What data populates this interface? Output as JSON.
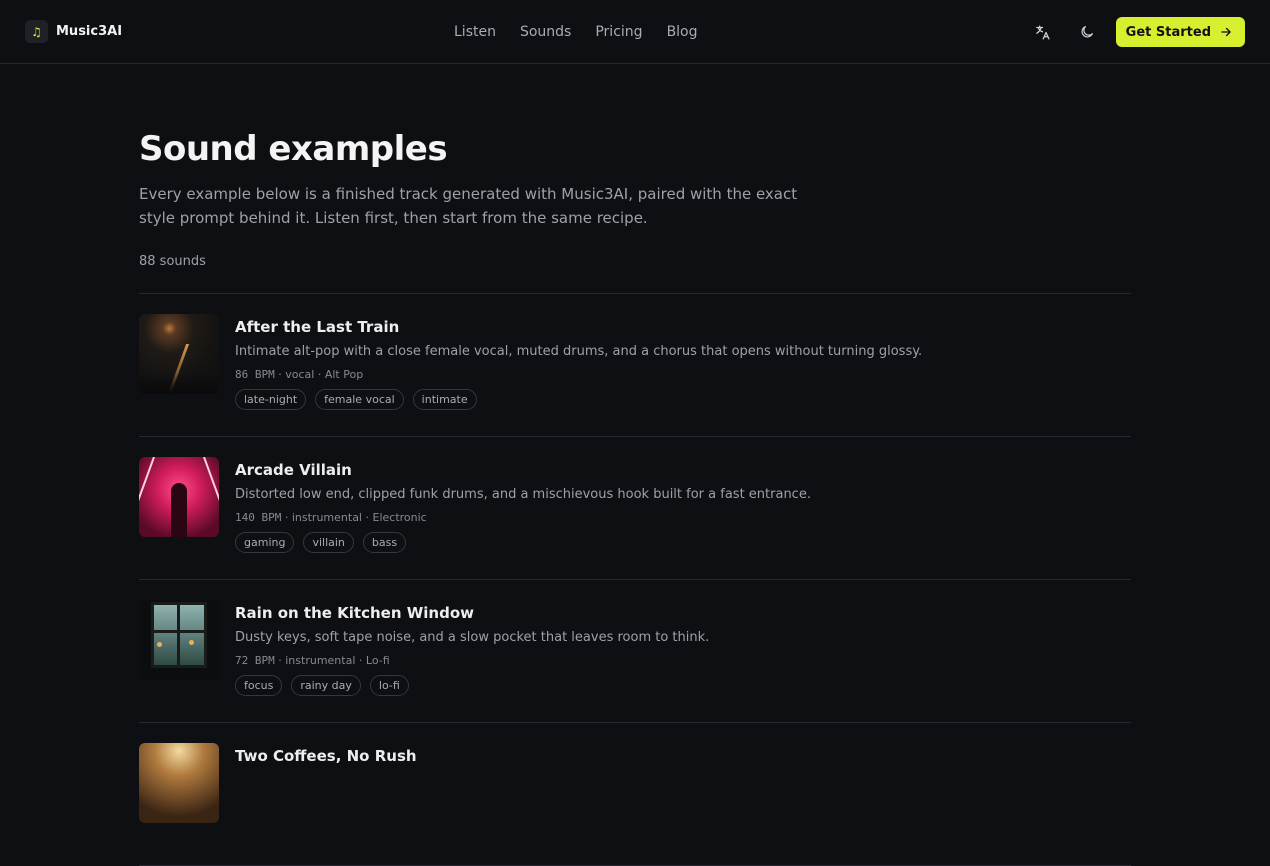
{
  "header": {
    "brand": "Music3AI",
    "nav": [
      "Listen",
      "Sounds",
      "Pricing",
      "Blog"
    ],
    "cta": "Get Started"
  },
  "page": {
    "title": "Sound examples",
    "subtitle": "Every example below is a finished track generated with Music3AI, paired with the exact style prompt behind it. Listen first, then start from the same recipe.",
    "count": "88 sounds"
  },
  "tracks": [
    {
      "title": "After the Last Train",
      "desc": "Intimate alt-pop with a close female vocal, muted drums, and a chorus that opens without turning glossy.",
      "bpm": "86 BPM",
      "type": "vocal",
      "genre": "Alt Pop",
      "tags": [
        "late-night",
        "female vocal",
        "intimate"
      ]
    },
    {
      "title": "Arcade Villain",
      "desc": "Distorted low end, clipped funk drums, and a mischievous hook built for a fast entrance.",
      "bpm": "140 BPM",
      "type": "instrumental",
      "genre": "Electronic",
      "tags": [
        "gaming",
        "villain",
        "bass"
      ]
    },
    {
      "title": "Rain on the Kitchen Window",
      "desc": "Dusty keys, soft tape noise, and a slow pocket that leaves room to think.",
      "bpm": "72 BPM",
      "type": "instrumental",
      "genre": "Lo-fi",
      "tags": [
        "focus",
        "rainy day",
        "lo-fi"
      ]
    },
    {
      "title": "Two Coffees, No Rush"
    }
  ]
}
